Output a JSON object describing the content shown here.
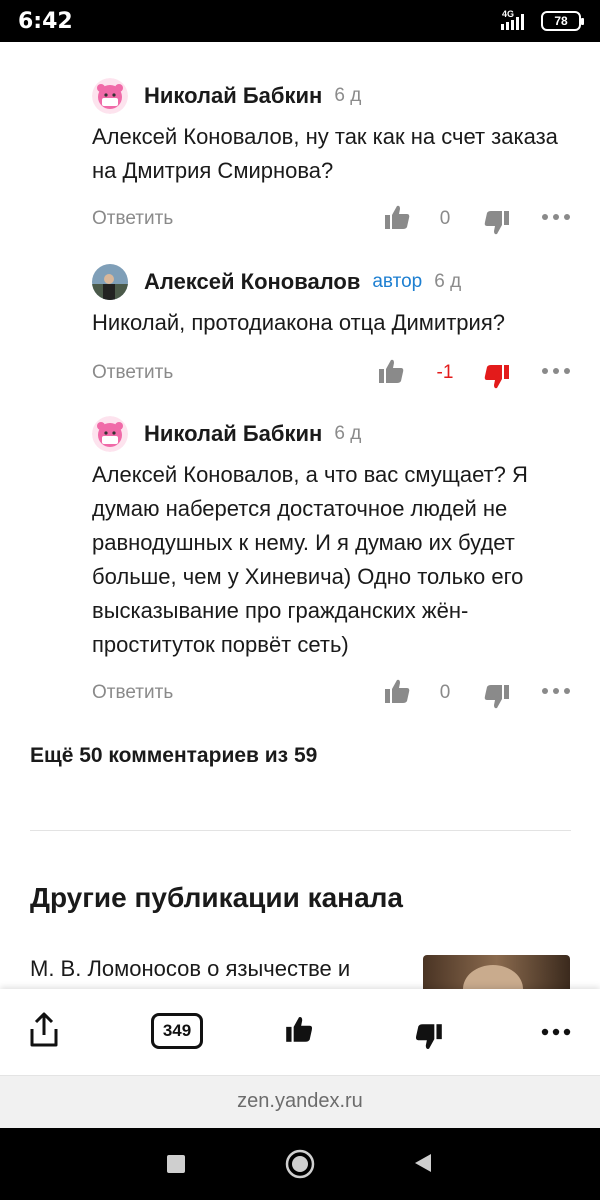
{
  "status_bar": {
    "time": "6:42",
    "network": "4G",
    "battery": "78"
  },
  "comments": [
    {
      "author": "Николай Бабкин",
      "badge": "",
      "time": "6 д",
      "text": "Алексей Коновалов, ну так как на счет заказа на Дмитрия Смирнова?",
      "reply_label": "Ответить",
      "score": "0",
      "avatar_icon": "pink-pig-mask-avatar"
    },
    {
      "author": "Алексей Коновалов",
      "badge": "автор",
      "time": "6 д",
      "text": "Николай, протодиакона отца Димитрия?",
      "reply_label": "Ответить",
      "score": "-1",
      "avatar_icon": "photo-avatar"
    },
    {
      "author": "Николай Бабкин",
      "badge": "",
      "time": "6 д",
      "text": "Алексей Коновалов, а что вас смущает? Я думаю наберется достаточное людей не равнодушных к нему. И я думаю их будет больше, чем у Хиневича) Одно только его высказывание про гражданских жён-проституток порвёт сеть)",
      "reply_label": "Ответить",
      "score": "0",
      "avatar_icon": "pink-pig-mask-avatar"
    }
  ],
  "more_comments": "Ещё 50 комментариев из 59",
  "other_publications": {
    "title": "Другие публикации канала",
    "first_item": "М. В. Ломоносов о язычестве и"
  },
  "action_bar": {
    "comments_count": "349"
  },
  "url_bar": {
    "url": "zen.yandex.ru"
  },
  "colors": {
    "accent_blue": "#1d7fd1",
    "negative_red": "#e31b1b",
    "muted_gray": "#8a8a8a",
    "pink_avatar": "#f06aa8"
  }
}
